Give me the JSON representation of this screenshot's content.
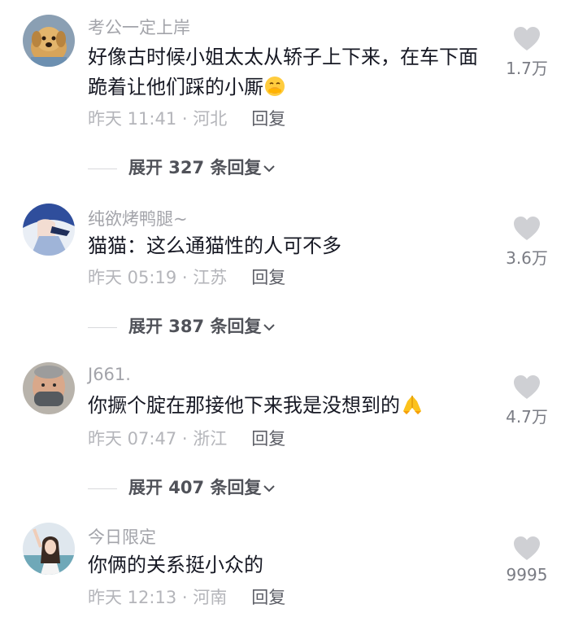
{
  "comments": [
    {
      "username": "考公一定上岸",
      "text": "好像古时候小姐太太从轿子上下来，在车下面跪着让他们踩的小厮",
      "emoji": "face-hand-over-mouth-emoji",
      "time_location": "昨天 11:41 · 河北",
      "reply_label": "回复",
      "like_count": "1.7万",
      "expand_label": "展开 327 条回复"
    },
    {
      "username": "纯欲烤鸭腿~",
      "text": "猫猫：这么通猫性的人可不多",
      "time_location": "昨天 05:19 · 江苏",
      "reply_label": "回复",
      "like_count": "3.6万",
      "expand_label": "展开 387 条回复"
    },
    {
      "username": "J661.",
      "text": "你撅个腚在那接他下来我是没想到的",
      "emoji": "folded-hands-emoji",
      "time_location": "昨天 07:47 · 浙江",
      "reply_label": "回复",
      "like_count": "4.7万",
      "expand_label": "展开 407 条回复"
    },
    {
      "username": "今日限定",
      "text": "你俩的关系挺小众的",
      "time_location": "昨天 12:13 · 河南",
      "reply_label": "回复",
      "like_count": "9995"
    }
  ],
  "colors": {
    "username": "#a3a4aa",
    "text": "#161823",
    "meta": "#b4b5ba",
    "reply": "#5c5e66",
    "heart": "#cfd0d4",
    "expand": "#505259"
  }
}
